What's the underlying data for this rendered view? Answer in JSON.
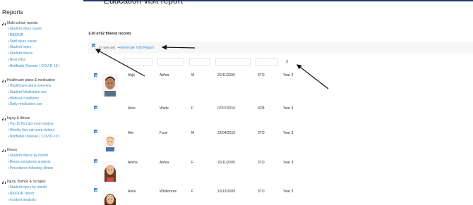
{
  "sidebar": {
    "title": "Reports",
    "groups": [
      {
        "label": "Multi school reports",
        "items": [
          "Student injury cause",
          "RIDDOR",
          "Staff injury cause",
          "Student Injury",
          "Student illness",
          "Near miss",
          "Notifiable Disease ( COVID-19 )"
        ]
      },
      {
        "label": "Healthcare plans & medication",
        "items": [
          "Healthcare plans overview",
          "Student Medication use",
          "Medical conditions",
          "Daily medication use"
        ]
      },
      {
        "label": "Injury & illness",
        "items": [
          "Top 10 first aid room visitors",
          "Weekly first aid room visitors",
          "Notifiable Disease ( COVID-19 )"
        ]
      },
      {
        "label": "Illness",
        "items": [
          "Student illness by month",
          "Illness symptoms analysis",
          "Procedures following illness"
        ]
      },
      {
        "label": "Injury, Bumps & Scrapes",
        "items": [
          "Student injury by month",
          "RIDDOR report",
          "Incident analysis"
        ]
      }
    ]
  },
  "main": {
    "title": "Education visit report",
    "record_count": "1-20 of 62 filtered records",
    "toolbar": {
      "selected_text": "57 selected",
      "generate_label": "Generate Visit Report"
    },
    "filters": {
      "year_value": "3"
    },
    "rows": [
      {
        "first": "Abjit",
        "last": "Abhra",
        "gender": "M",
        "dob": "20/11/2009",
        "reg": "3TO",
        "year": "Year 3",
        "photo": "boy-dark"
      },
      {
        "first": "Alice",
        "last": "Wade",
        "gender": "F",
        "dob": "07/07/2010",
        "reg": "3CB",
        "year": "Year 3",
        "photo": ""
      },
      {
        "first": "Alin",
        "last": "Fane",
        "gender": "M",
        "dob": "22/04/2010",
        "reg": "3TO",
        "year": "Year 3",
        "photo": "boy-fair"
      },
      {
        "first": "Alisha",
        "last": "Abhra",
        "gender": "F",
        "dob": "20/11/2009",
        "reg": "3TO",
        "year": "Year 3",
        "photo": "girl-brown"
      },
      {
        "first": "Amie",
        "last": "Whitemore",
        "gender": "F",
        "dob": "10/12/2009",
        "reg": "3TO",
        "year": "Year 3",
        "photo": "girl-brown"
      }
    ]
  },
  "colors": {
    "link": "#3a8fc9",
    "checkbox": "#2f7bd8",
    "topbar": "#1f3a6e"
  }
}
